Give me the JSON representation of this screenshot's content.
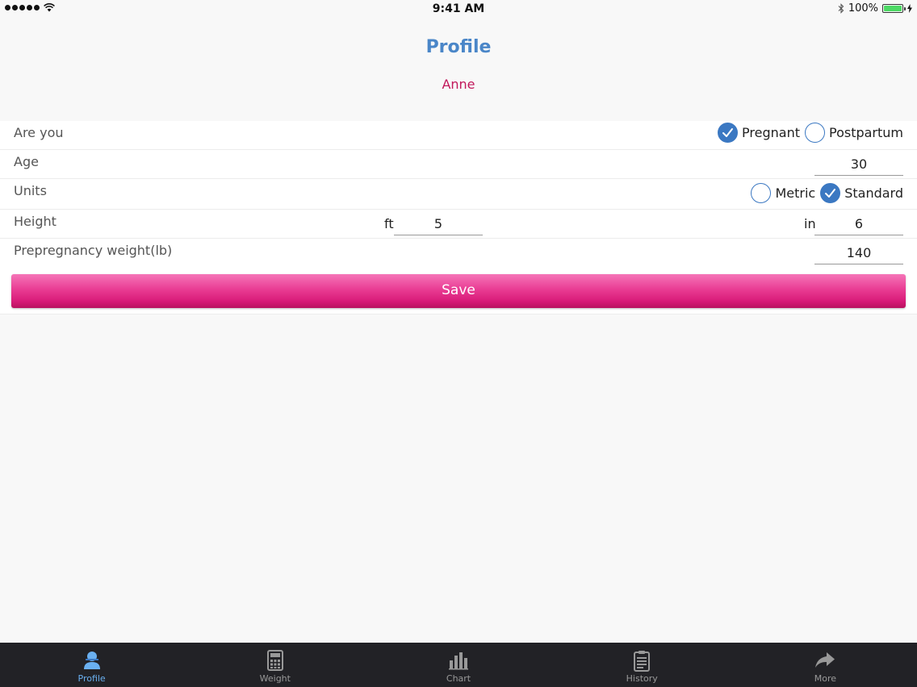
{
  "status_bar": {
    "time": "9:41 AM",
    "battery": "100%"
  },
  "header": {
    "title": "Profile",
    "user_name": "Anne"
  },
  "form": {
    "status": {
      "label": "Are you",
      "options": [
        {
          "label": "Pregnant",
          "checked": true
        },
        {
          "label": "Postpartum",
          "checked": false
        }
      ]
    },
    "age": {
      "label": "Age",
      "value": "30"
    },
    "units": {
      "label": "Units",
      "options": [
        {
          "label": "Metric",
          "checked": false
        },
        {
          "label": "Standard",
          "checked": true
        }
      ]
    },
    "height": {
      "label": "Height",
      "ft_label": "ft",
      "ft_value": "5",
      "in_label": "in",
      "in_value": "6"
    },
    "weight": {
      "label": "Prepregnancy weight(lb)",
      "value": "140"
    },
    "save_label": "Save"
  },
  "tabs": [
    {
      "label": "Profile",
      "icon": "person-icon",
      "active": true
    },
    {
      "label": "Weight",
      "icon": "calculator-icon",
      "active": false
    },
    {
      "label": "Chart",
      "icon": "bar-chart-icon",
      "active": false
    },
    {
      "label": "History",
      "icon": "clipboard-icon",
      "active": false
    },
    {
      "label": "More",
      "icon": "share-arrow-icon",
      "active": false
    }
  ],
  "colors": {
    "title": "#4a86c8",
    "name": "#c2185b",
    "accent": "#3b78c2",
    "save_button": "#e0288a",
    "tab_active": "#6ab0f0",
    "tab_bar": "#222226"
  }
}
